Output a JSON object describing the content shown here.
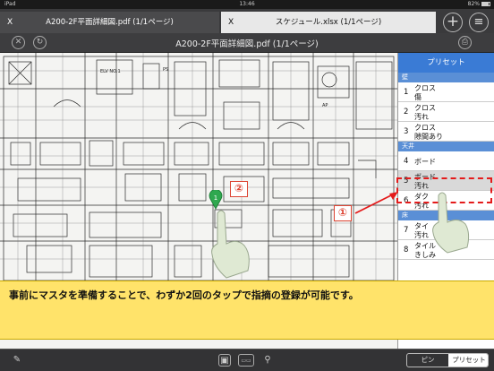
{
  "status_bar": {
    "carrier": "iPad",
    "time": "13:46",
    "battery": "82%",
    "battery_level": 0.82
  },
  "tabs": [
    {
      "close": "X",
      "title": "A200-2F平面詳細図.pdf (1/1ページ)",
      "active": true
    },
    {
      "close": "X",
      "title": "スケジュール.xlsx (1/1ページ)",
      "active": false
    }
  ],
  "tab_actions": {
    "add": "+",
    "menu": "≡"
  },
  "viewer": {
    "title": "A200-2F平面詳細図.pdf (1/1ページ)"
  },
  "preset_panel": {
    "header": "プリセット",
    "sections": [
      {
        "name": "壁",
        "items": [
          {
            "num": "1",
            "line1": "クロス",
            "line2": "傷"
          },
          {
            "num": "2",
            "line1": "クロス",
            "line2": "汚れ"
          },
          {
            "num": "3",
            "line1": "クロス",
            "line2": "隙間あり"
          }
        ]
      },
      {
        "name": "天井",
        "items": [
          {
            "num": "4",
            "line1": "ボード",
            "line2": ""
          },
          {
            "num": "5",
            "line1": "ボード",
            "line2": "汚れ",
            "selected": true
          },
          {
            "num": "6",
            "line1": "ダク",
            "line2": "汚れ"
          }
        ]
      },
      {
        "name": "床",
        "items": [
          {
            "num": "7",
            "line1": "タイ",
            "line2": "汚れ"
          },
          {
            "num": "8",
            "line1": "タイル",
            "line2": "きしみ"
          }
        ]
      }
    ]
  },
  "annotations": {
    "marker1": "①",
    "marker2": "②",
    "pin_label": "1",
    "callout": "事前にマスタを準備することで、わずか2回のタップで指摘の登録が可能です。"
  },
  "drawing_labels": {
    "elv": "ELV NO.1",
    "ps": "PS",
    "ap": "AP",
    "scroll_plus": "+"
  },
  "bottom_bar": {
    "segment_pin": "ピン",
    "segment_preset": "プリセット",
    "selected": "プリセット"
  },
  "colors": {
    "accent": "#3a7bd5",
    "callout_bg": "#ffe36a",
    "marker_red": "#e41b1b",
    "pin_green": "#2fa84f"
  }
}
